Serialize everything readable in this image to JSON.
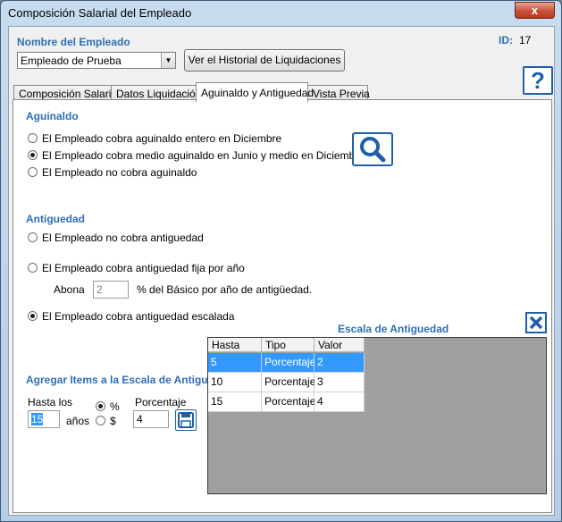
{
  "window": {
    "title": "Composición Salarial del Empleado",
    "close_label": "x"
  },
  "employee": {
    "label": "Nombre del Empleado",
    "selected": "Empleado de Prueba",
    "history_button": "Ver el Historial de Liquidaciones",
    "id_label": "ID:",
    "id_value": "17"
  },
  "help_label": "?",
  "tabs": [
    {
      "label": "Composición Salarial"
    },
    {
      "label": "Datos Liquidación"
    },
    {
      "label": "Aguinaldo y Antiguedad"
    },
    {
      "label": "Vista Previa"
    }
  ],
  "aguinaldo": {
    "title": "Aguinaldo",
    "options": [
      {
        "label": "El Empleado cobra aguinaldo entero en Diciembre",
        "checked": false
      },
      {
        "label": "El Empleado cobra medio aguinaldo en Junio y medio en Diciemb",
        "checked": true
      },
      {
        "label": "El Empleado no cobra aguinaldo",
        "checked": false
      }
    ]
  },
  "antiguedad": {
    "title": "Antiguedad",
    "opt_none": "El Empleado no cobra antiguedad",
    "opt_fixed": "El Empleado cobra antiguedad fija por año",
    "abona_label": "Abona",
    "abona_value": "2",
    "abona_suffix": "% del Básico por año de antigüedad.",
    "opt_scaled": "El Empleado cobra antiguedad escalada",
    "selected": "scaled"
  },
  "escala": {
    "title": "Escala de Antiguedad",
    "columns": [
      "Hasta",
      "Tipo",
      "Valor"
    ],
    "rows": [
      {
        "hasta": "5",
        "tipo": "Porcentaje",
        "valor": "2",
        "selected": true
      },
      {
        "hasta": "10",
        "tipo": "Porcentaje",
        "valor": "3",
        "selected": false
      },
      {
        "hasta": "15",
        "tipo": "Porcentaje",
        "valor": "4",
        "selected": false
      }
    ]
  },
  "agregar": {
    "title": "Agregar Items a la Escala de Antigu",
    "hasta_label": "Hasta los",
    "hasta_value": "15",
    "anios_label": "años",
    "pct_symbol": "%",
    "money_symbol": "$",
    "pct_checked": true,
    "porcentaje_label": "Porcentaje",
    "porcentaje_value": "4"
  },
  "colors": {
    "accent": "#2e6fb5",
    "selection": "#3399ff",
    "icon_blue": "#1f5fa8"
  }
}
